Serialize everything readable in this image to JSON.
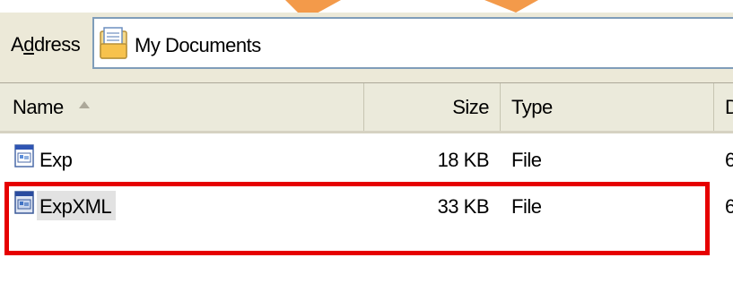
{
  "address": {
    "label_prefix": "A",
    "label_mnemonic": "d",
    "label_suffix": "dress",
    "value": "My Documents",
    "folder_icon": "my-documents-folder-icon"
  },
  "columns": {
    "name": "Name",
    "size": "Size",
    "type": "Type",
    "date_partial": "D"
  },
  "files": [
    {
      "name": "Exp",
      "size": "18 KB",
      "type": "File",
      "date_partial": "6",
      "icon": "application-window-icon"
    },
    {
      "name": "ExpXML",
      "size": "33 KB",
      "type": "File",
      "date_partial": "6",
      "icon": "application-window-icon",
      "highlighted": true
    }
  ],
  "colors": {
    "highlight_border": "#e60000",
    "toolbar_bg": "#ece9d8",
    "address_border": "#7f9db9",
    "top_accent": "#f39a4a"
  }
}
